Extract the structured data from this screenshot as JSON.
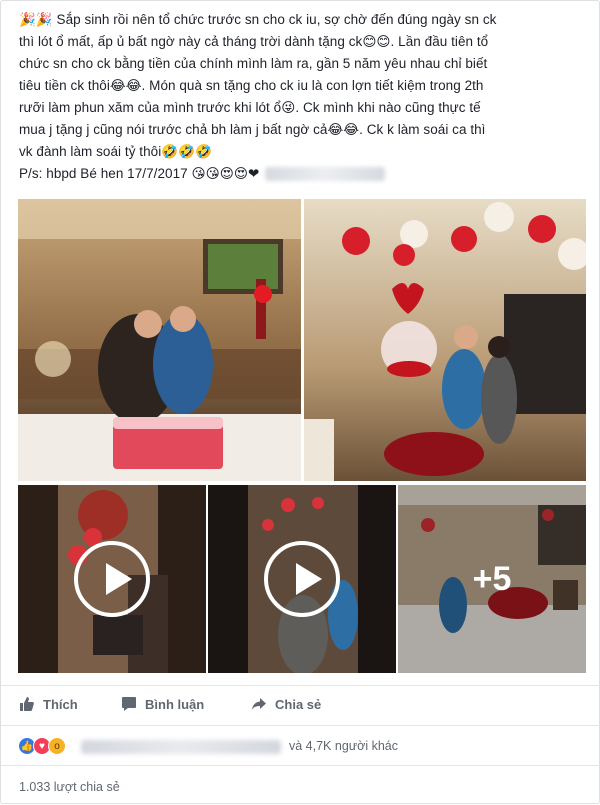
{
  "post": {
    "lines": [
      "🎉🎉 Sắp sinh rồi nên tổ chức trước sn cho ck iu, sợ chờ đến đúng ngày sn ck",
      "thì lót ổ mất, ấp ủ bất ngờ này cả tháng trời dành tặng ck😊😊. Lần đầu tiên tổ",
      "chức sn cho ck bằng tiền của chính mình làm ra, gần 5 năm yêu nhau chỉ biết",
      "tiêu tiền ck thôi😂😂. Món quà sn tặng cho ck iu là con lợn tiết kiệm trong 2th",
      "rưỡi làm phun xăm của mình trước khi lót ổ😜. Ck mình khi nào cũng thực tế",
      "mua j tặng j cũng nói trước chả bh làm j bất ngờ cả😂😂. Ck k làm soái ca thì",
      "vk đành làm soái tỷ thôi🤣🤣🤣",
      "P/s: hbpd Bé hen 17/7/2017 😘😘😍😍❤"
    ]
  },
  "media": {
    "more_count": "+5"
  },
  "actions": {
    "like": "Thích",
    "comment": "Bình luận",
    "share": "Chia sẻ"
  },
  "reactions": {
    "text": "và 4,7K người khác"
  },
  "shares": {
    "text": "1.033 lượt chia sẻ"
  },
  "colors": {
    "like_blue": "#3578e5",
    "love_red": "#f33e58",
    "wow_yellow": "#f7b125",
    "action_gray": "#606770"
  }
}
